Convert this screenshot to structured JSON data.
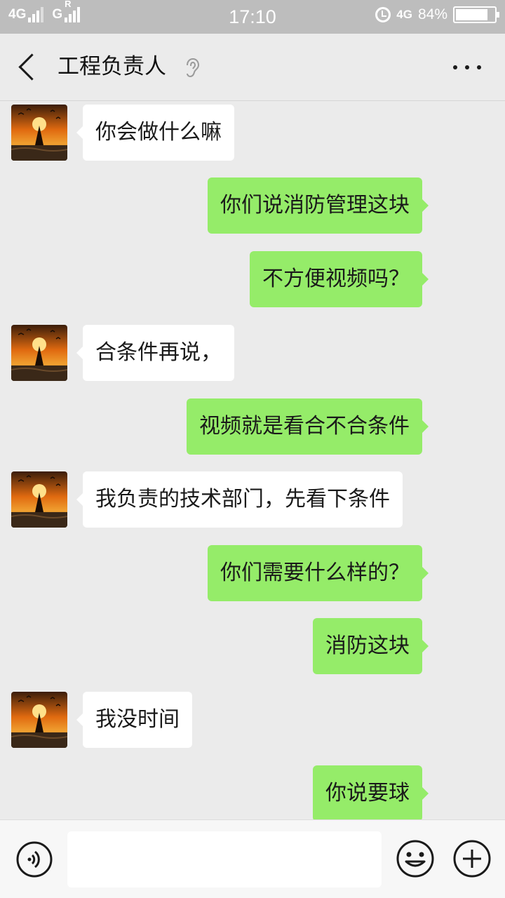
{
  "status_bar": {
    "sim1_label": "4G",
    "sim2_label": "G",
    "sim2_roaming": "R",
    "time": "17:10",
    "network_label": "4G",
    "battery_percent": "84%",
    "battery_level": 0.84
  },
  "header": {
    "title": "工程负责人",
    "back_icon": "chevron-left-icon",
    "earpiece_icon": "ear-icon",
    "more_icon": "more-dots-icon"
  },
  "messages": [
    {
      "side": "left",
      "text": "你会做什么嘛"
    },
    {
      "side": "right",
      "text": "你们说消防管理这块"
    },
    {
      "side": "right",
      "text": "不方便视频吗？"
    },
    {
      "side": "left",
      "text": "合条件再说，"
    },
    {
      "side": "right",
      "text": "视频就是看合不合条件"
    },
    {
      "side": "left",
      "text": "我负责的技术部门，先看下条件"
    },
    {
      "side": "right",
      "text": "你们需要什么样的？"
    },
    {
      "side": "right",
      "text": "消防这块"
    },
    {
      "side": "left",
      "text": "我没时间"
    },
    {
      "side": "right",
      "text": "你说要球"
    }
  ],
  "input_bar": {
    "voice_icon": "voice-icon",
    "input_value": "",
    "emoji_icon": "emoji-icon",
    "plus_icon": "plus-icon"
  },
  "colors": {
    "right_bubble": "#95ec69",
    "left_bubble": "#ffffff",
    "background": "#ebebeb"
  }
}
